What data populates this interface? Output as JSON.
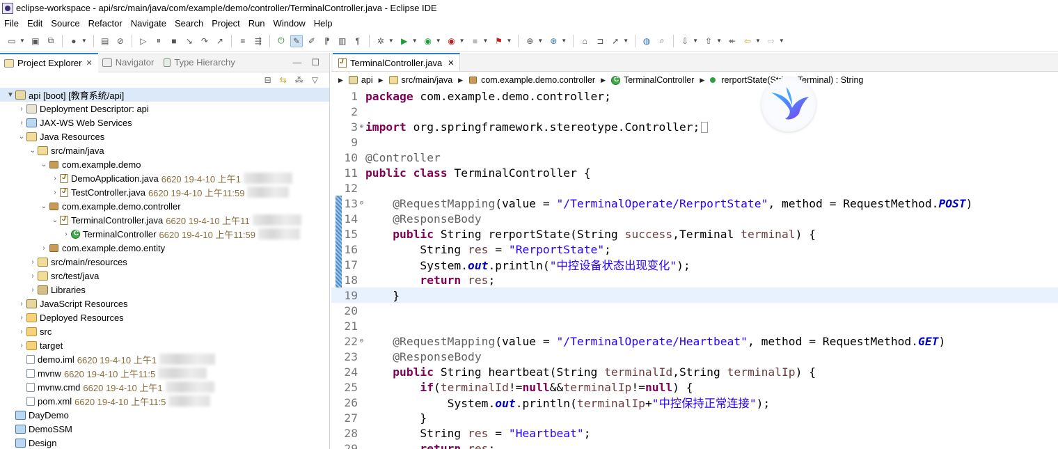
{
  "window": {
    "title": "eclipse-workspace - api/src/main/java/com/example/demo/controller/TerminalController.java - Eclipse IDE"
  },
  "menu": [
    "File",
    "Edit",
    "Source",
    "Refactor",
    "Navigate",
    "Search",
    "Project",
    "Run",
    "Window",
    "Help"
  ],
  "left_tabs": {
    "project_explorer": "Project Explorer",
    "navigator": "Navigator",
    "type_hierarchy": "Type Hierarchy"
  },
  "tree": [
    {
      "label": "api [boot] [教育系统/api]",
      "decor": "",
      "icon": "project-icon"
    },
    {
      "label": "Deployment Descriptor: api",
      "decor": "",
      "icon": "descriptor-icon"
    },
    {
      "label": "JAX-WS Web Services",
      "decor": "",
      "icon": "web-services-icon"
    },
    {
      "label": "Java Resources",
      "decor": "",
      "icon": "java-resources-icon"
    },
    {
      "label": "src/main/java",
      "decor": "",
      "icon": "source-folder-icon"
    },
    {
      "label": "com.example.demo",
      "decor": "",
      "icon": "package-icon"
    },
    {
      "label": "DemoApplication.java",
      "decor": "6620  19-4-10 上午1",
      "icon": "java-file-icon"
    },
    {
      "label": "TestController.java",
      "decor": "6620  19-4-10 上午11:59",
      "icon": "java-file-icon"
    },
    {
      "label": "com.example.demo.controller",
      "decor": "",
      "icon": "package-icon"
    },
    {
      "label": "TerminalController.java",
      "decor": "6620  19-4-10 上午11",
      "icon": "java-file-icon"
    },
    {
      "label": "TerminalController",
      "decor": "6620  19-4-10 上午11:59",
      "icon": "class-icon"
    },
    {
      "label": "com.example.demo.entity",
      "decor": "",
      "icon": "package-icon"
    },
    {
      "label": "src/main/resources",
      "decor": "",
      "icon": "source-folder-icon"
    },
    {
      "label": "src/test/java",
      "decor": "",
      "icon": "source-folder-icon"
    },
    {
      "label": "Libraries",
      "decor": "",
      "icon": "libraries-icon"
    },
    {
      "label": "JavaScript Resources",
      "decor": "",
      "icon": "javascript-resources-icon"
    },
    {
      "label": "Deployed Resources",
      "decor": "",
      "icon": "folder-icon"
    },
    {
      "label": "src",
      "decor": "",
      "icon": "folder-icon"
    },
    {
      "label": "target",
      "decor": "",
      "icon": "folder-icon"
    },
    {
      "label": "demo.iml",
      "decor": "6620  19-4-10 上午1",
      "icon": "file-icon"
    },
    {
      "label": "mvnw",
      "decor": "6620  19-4-10 上午11:5",
      "icon": "file-icon"
    },
    {
      "label": "mvnw.cmd",
      "decor": "6620  19-4-10 上午1",
      "icon": "file-icon"
    },
    {
      "label": "pom.xml",
      "decor": "6620  19-4-10 上午11:5",
      "icon": "file-icon"
    },
    {
      "label": "DayDemo",
      "decor": "",
      "icon": "workspace-project-icon"
    },
    {
      "label": "DemoSSM",
      "decor": "",
      "icon": "workspace-project-icon"
    },
    {
      "label": "Design",
      "decor": "",
      "icon": "workspace-project-icon"
    }
  ],
  "editor": {
    "tab_label": "TerminalController.java",
    "breadcrumb": {
      "project": "api",
      "source_folder": "src/main/java",
      "package": "com.example.demo.controller",
      "class": "TerminalController",
      "method": "rerportState(String, Terminal) : String"
    },
    "line_numbers": [
      "1",
      "2",
      "3",
      "9",
      "10",
      "11",
      "12",
      "13",
      "14",
      "15",
      "16",
      "17",
      "18",
      "19",
      "20",
      "21",
      "22",
      "23",
      "24",
      "25",
      "26",
      "27",
      "28",
      "29"
    ],
    "code": {
      "l1_kw": "package",
      "l1_rest": " com.example.demo.controller;",
      "l3_kw": "import",
      "l3_rest": " org.springframework.stereotype.Controller;",
      "l10_ann": "@Controller",
      "l11_kw1": "public",
      "l11_kw2": "class",
      "l11_rest": " TerminalController {",
      "l13_ann": "@RequestMapping",
      "l13_a": "(value = ",
      "l13_str": "\"/TerminalOperate/RerportState\"",
      "l13_b": ", method = RequestMethod.",
      "l13_const": "POST",
      "l13_c": ")",
      "l14_ann": "@ResponseBody",
      "l15_kw": "public",
      "l15_a": " String rerportState(String ",
      "l15_p1": "success",
      "l15_b": ",Terminal ",
      "l15_p2": "terminal",
      "l15_c": ") {",
      "l16_a": "String ",
      "l16_var": "res",
      "l16_b": " = ",
      "l16_str": "\"RerportState\"",
      "l16_c": ";",
      "l17_a": "System.",
      "l17_out": "out",
      "l17_b": ".println(",
      "l17_str": "\"中控设备状态出现变化\"",
      "l17_c": ");",
      "l18_kw": "return",
      "l18_var": " res",
      "l18_c": ";",
      "l19": "}",
      "l22_ann": "@RequestMapping",
      "l22_a": "(value = ",
      "l22_str": "\"/TerminalOperate/Heartbeat\"",
      "l22_b": ", method = RequestMethod.",
      "l22_const": "GET",
      "l22_c": ")",
      "l23_ann": "@ResponseBody",
      "l24_kw": "public",
      "l24_a": " String heartbeat(String ",
      "l24_p1": "terminalId",
      "l24_b": ",String ",
      "l24_p2": "terminalIp",
      "l24_c": ") {",
      "l25_kw": "if",
      "l25_a": "(",
      "l25_p1": "terminalId",
      "l25_b": "!=",
      "l25_null1": "null",
      "l25_c": "&&",
      "l25_p2": "terminalIp",
      "l25_d": "!=",
      "l25_null2": "null",
      "l25_e": ") {",
      "l26_a": "System.",
      "l26_out": "out",
      "l26_b": ".println(",
      "l26_p": "terminalIp",
      "l26_c": "+",
      "l26_str": "\"中控保持正常连接\"",
      "l26_d": ");",
      "l27": "}",
      "l28_a": "String ",
      "l28_var": "res",
      "l28_b": " = ",
      "l28_str": "\"Heartbeat\"",
      "l28_c": ";",
      "l29_kw": "return",
      "l29_var": " res",
      "l29_c": ";"
    }
  },
  "colors": {
    "keyword": "#7f0055",
    "string": "#2a00ff",
    "annotation": "#646464",
    "parameter": "#6a3e3e",
    "static_field": "#0000c0",
    "current_line": "#e8f2fe",
    "active_tab_accent": "#2f7dd0"
  }
}
